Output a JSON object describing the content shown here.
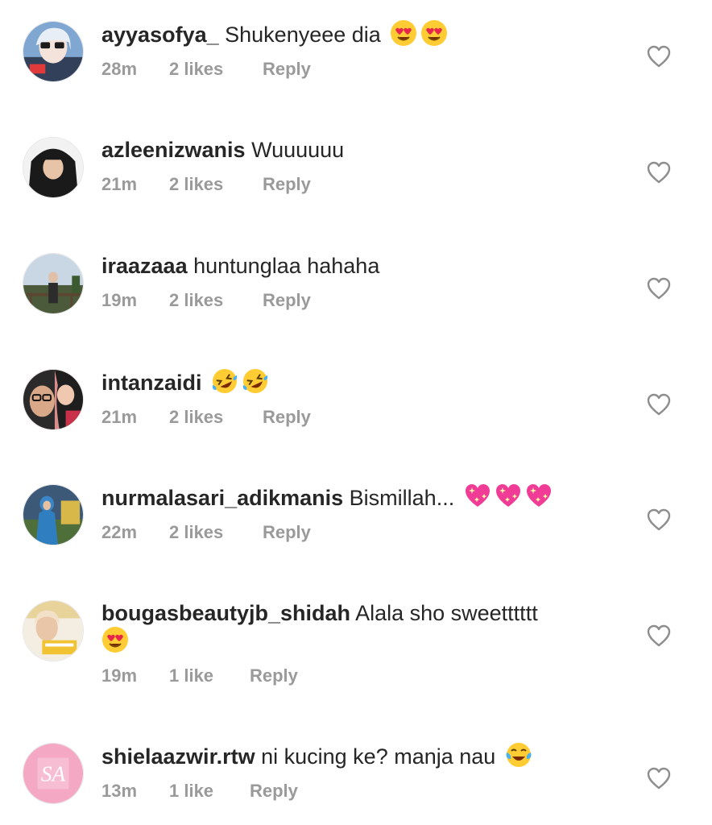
{
  "comments": [
    {
      "username": "ayyasofya_",
      "text": "Shukenyeee dia",
      "emojis": [
        "heart-eyes-emoji",
        "heart-eyes-emoji"
      ],
      "time": "28m",
      "likes": "2 likes",
      "reply": "Reply",
      "avatar_icon": "profile-photo-avatar"
    },
    {
      "username": "azleenizwanis",
      "text": "Wuuuuuu",
      "emojis": [],
      "time": "21m",
      "likes": "2 likes",
      "reply": "Reply",
      "avatar_icon": "profile-photo-avatar"
    },
    {
      "username": "iraazaaa",
      "text": "huntunglaa hahaha",
      "emojis": [],
      "time": "19m",
      "likes": "2 likes",
      "reply": "Reply",
      "avatar_icon": "profile-photo-avatar"
    },
    {
      "username": "intanzaidi",
      "text": "",
      "emojis": [
        "rolling-laughing-emoji",
        "rolling-laughing-emoji"
      ],
      "time": "21m",
      "likes": "2 likes",
      "reply": "Reply",
      "avatar_icon": "profile-photo-avatar"
    },
    {
      "username": "nurmalasari_adikmanis",
      "text": "Bismillah...",
      "emojis": [
        "sparkling-heart-emoji",
        "sparkling-heart-emoji",
        "sparkling-heart-emoji"
      ],
      "time": "22m",
      "likes": "2 likes",
      "reply": "Reply",
      "avatar_icon": "profile-photo-avatar"
    },
    {
      "username": "bougasbeautyjb_shidah",
      "text": "Alala sho sweetttttt",
      "emojis": [
        "heart-eyes-emoji"
      ],
      "time": "19m",
      "likes": "1 like",
      "reply": "Reply",
      "avatar_icon": "profile-photo-avatar"
    },
    {
      "username": "shielaazwir.rtw",
      "text": "ni kucing ke? manja nau",
      "emojis": [
        "tears-of-joy-emoji"
      ],
      "time": "13m",
      "likes": "1 like",
      "reply": "Reply",
      "avatar_icon": "logo-avatar",
      "avatar_logo_text": "SA"
    }
  ],
  "colors": {
    "text": "#262626",
    "meta": "#9a9a9a",
    "heart_outline": "#8e8e8e",
    "emoji_face": "#ffcc33",
    "emoji_heart": "#e8254a",
    "sparkle_heart": "#f03c96"
  },
  "like_icon": "heart-outline-icon"
}
